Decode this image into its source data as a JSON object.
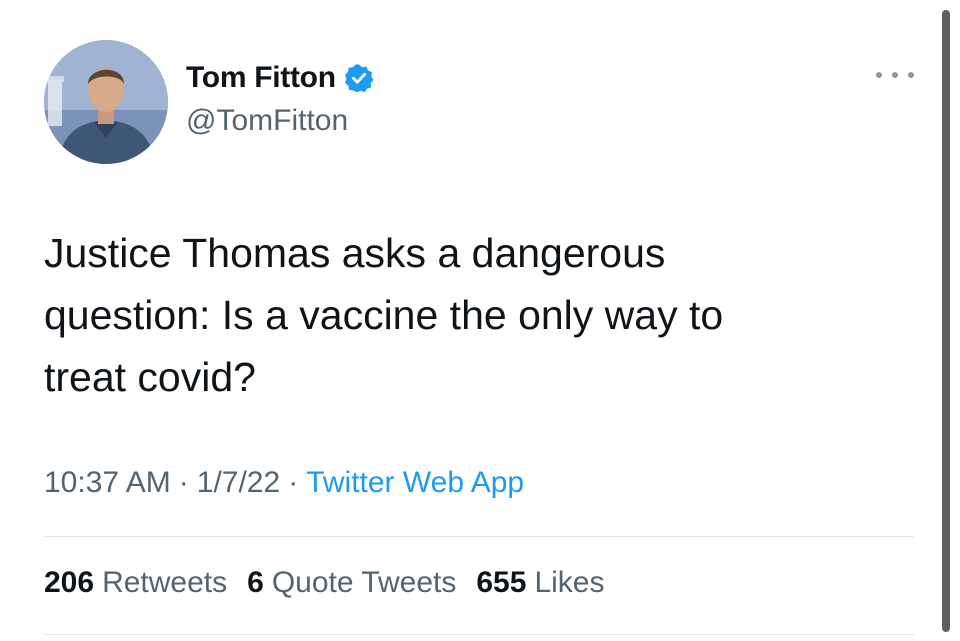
{
  "author": {
    "display_name": "Tom Fitton",
    "handle": "@TomFitton",
    "verified_icon": "verified-badge-icon",
    "avatar_icon": "profile-photo"
  },
  "tweet": {
    "text": "Justice Thomas asks a dangerous\nquestion: Is a vaccine the only way to\ntreat covid?"
  },
  "meta": {
    "time": "10:37 AM",
    "separator": "·",
    "date": "1/7/22",
    "source": "Twitter Web App"
  },
  "stats": [
    {
      "number": "206",
      "label": "Retweets"
    },
    {
      "number": "6",
      "label": "Quote Tweets"
    },
    {
      "number": "655",
      "label": "Likes"
    }
  ],
  "colors": {
    "accent": "#1d9bf0",
    "text_primary": "#0f1419",
    "text_secondary": "#536471",
    "divider": "#e1e6ea"
  },
  "more_menu_icon": "more-horizontal-icon"
}
